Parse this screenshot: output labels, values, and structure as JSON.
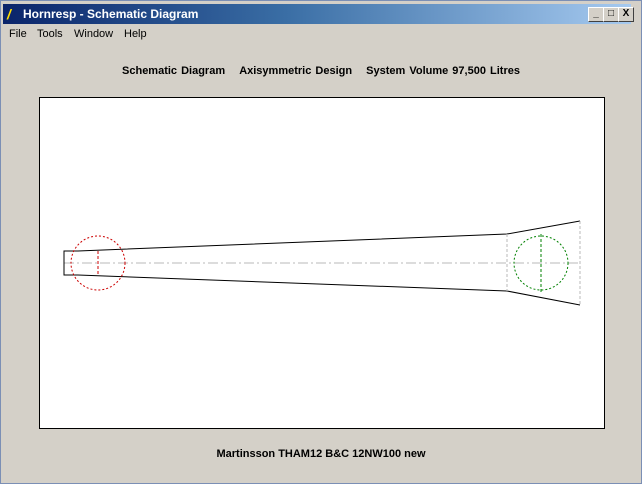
{
  "window": {
    "title": "Hornresp - Schematic Diagram",
    "icon": "lightning-icon",
    "controls": [
      "minimize",
      "maximize",
      "close"
    ]
  },
  "menu": [
    "File",
    "Tools",
    "Window",
    "Help"
  ],
  "header": {
    "view": "Schematic Diagram",
    "design": "Axisymmetric Design",
    "volume": "System Volume 97,500 Litres"
  },
  "footer": {
    "record_name": "Martinsson THAM12 B&C 12NW100 new"
  },
  "colors": {
    "driver_rear": "#cc0000",
    "driver_front": "#008000",
    "centerline": "#b0b0b0"
  }
}
